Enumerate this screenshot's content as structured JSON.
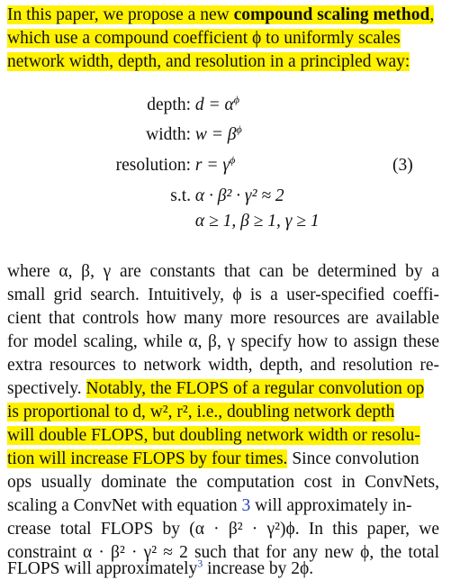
{
  "intro": {
    "line1_pre": "In this paper, we propose a new ",
    "line1_bold": "compound scaling method",
    "line1_post": ",",
    "line2": "which use a compound coefficient ϕ to uniformly scales",
    "line3": "network width, depth, and resolution in a principled way:"
  },
  "equation": {
    "rows": [
      {
        "label": "depth:",
        "expr": "d = α"
      },
      {
        "label": "width:",
        "expr": "w = β"
      },
      {
        "label": "resolution:",
        "expr": "r = γ"
      },
      {
        "label": "s.t.",
        "expr": "α · β² · γ² ≈ 2"
      },
      {
        "label": "",
        "expr": "α ≥ 1, β ≥ 1, γ ≥ 1"
      }
    ],
    "sup": "ϕ",
    "number": "(3)"
  },
  "body": {
    "l1": "where α, β, γ are constants that can be determined by a",
    "l2": "small grid search.  Intuitively, ϕ is a user-specified coeffi-",
    "l3": "cient that controls how many more resources are available",
    "l4": "for model scaling, while α, β, γ specify how to assign these",
    "l5": "extra resources to network width, depth, and resolution re-",
    "l6_pre": "spectively. ",
    "l6_hl": "Notably, the FLOPS of a regular convolution op",
    "l7": "is proportional to d, w², r², i.e., doubling network depth",
    "l8": "will double FLOPS, but doubling network width or resolu-",
    "l9_hl": "tion will increase FLOPS by four times.",
    "l9_post": " Since convolution",
    "l10": "ops usually dominate the computation cost in ConvNets,",
    "l11_pre": "scaling a ConvNet with equation ",
    "l11_ref": "3",
    "l11_post": " will approximately in-",
    "l12": "crease total FLOPS by (α · β² · γ²)ϕ.  In this paper, we",
    "l13": "constraint α · β² · γ² ≈ 2 such that for any new ϕ, the total",
    "l14_pre": "FLOPS will approximately",
    "l14_fn": "3",
    "l14_post": " increase by 2ϕ."
  }
}
